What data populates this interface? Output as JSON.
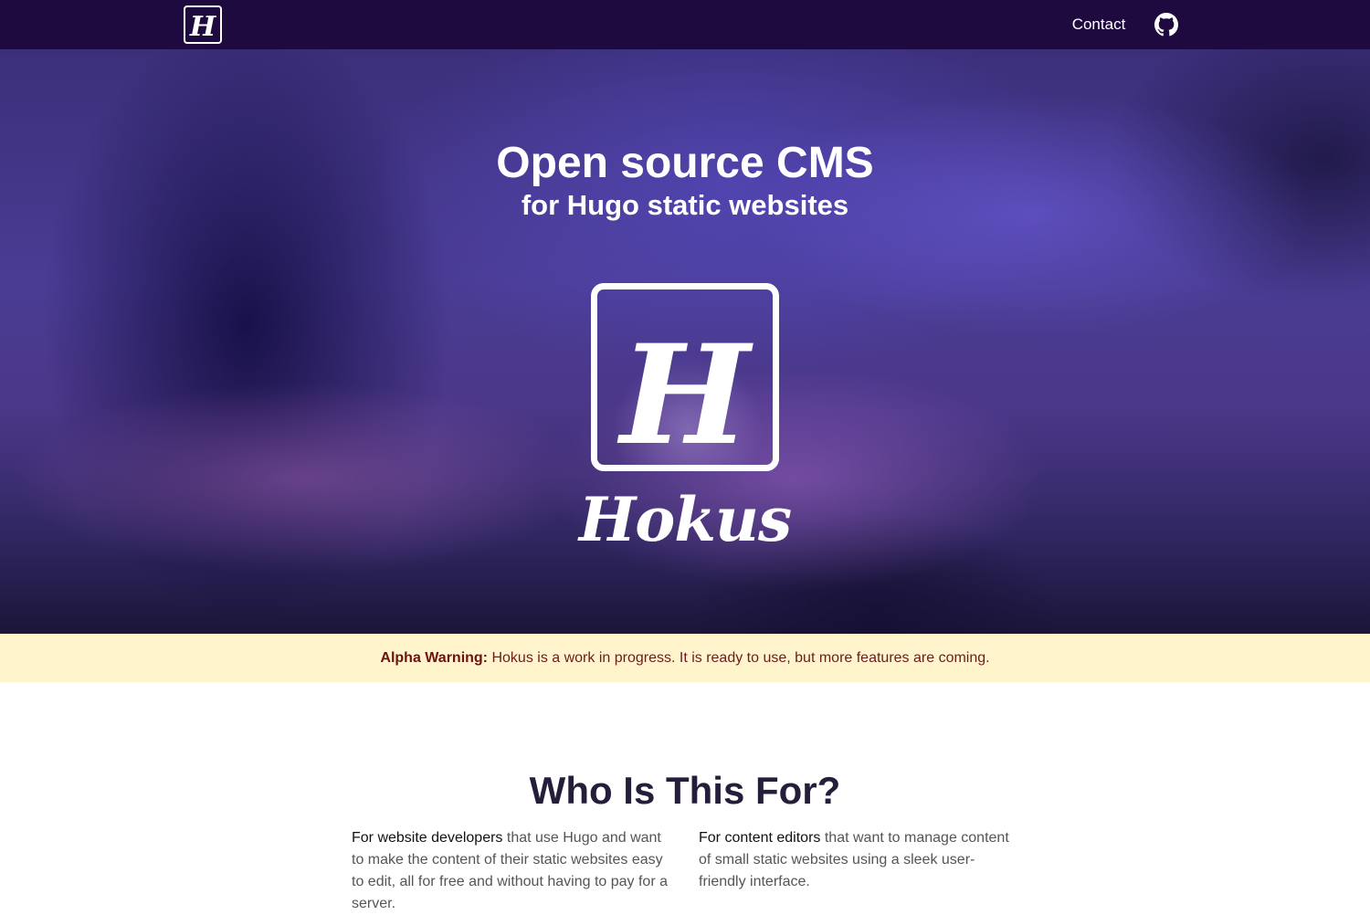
{
  "nav": {
    "logo_letter": "H",
    "contact_label": "Contact",
    "github_icon": "github-icon"
  },
  "hero": {
    "title": "Open source CMS",
    "subtitle": "for Hugo static websites",
    "logo_letter": "H",
    "wordmark": "Hokus"
  },
  "alert": {
    "label": "Alpha Warning:",
    "text": " Hokus is a work in progress. It is ready to use, but more features are coming."
  },
  "who": {
    "heading": "Who Is This For?",
    "developers_strong": "For website developers",
    "developers_text": " that use Hugo and want to make the content of their static websites easy to edit, all for free and without having to pay for a server.",
    "editors_strong": "For content editors",
    "editors_text": " that want to manage content of small static websites using a sleek user-friendly interface."
  },
  "colors": {
    "nav_bg": "#1e0a3f",
    "alert_bg": "#fff4cc",
    "alert_text": "#6b1d1d",
    "heading": "#251d3a"
  }
}
